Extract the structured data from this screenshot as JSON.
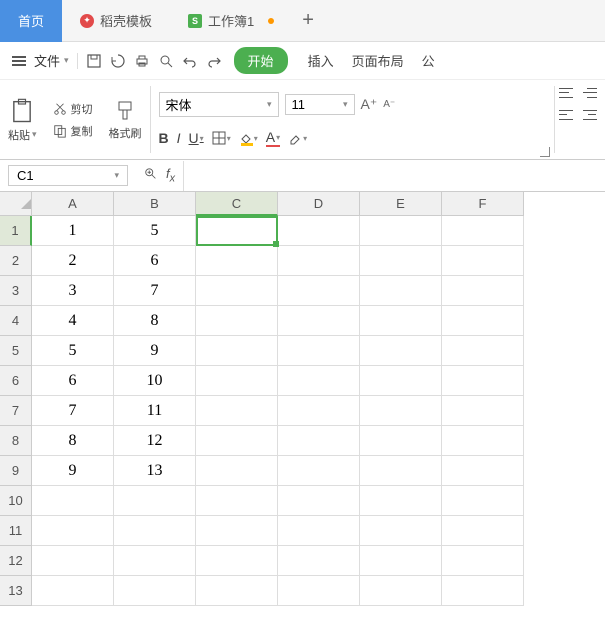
{
  "tabs": {
    "home": "首页",
    "template": "稻壳模板",
    "workbook": "工作簿1"
  },
  "menuBar": {
    "file": "文件",
    "begin": "开始",
    "insert": "插入",
    "pageLayout": "页面布局",
    "formula": "公"
  },
  "ribbon": {
    "paste": "粘贴",
    "cut": "剪切",
    "copy": "复制",
    "formatPainter": "格式刷",
    "fontName": "宋体",
    "fontSize": "11"
  },
  "nameBox": "C1",
  "formulaBar": "",
  "columns": [
    "A",
    "B",
    "C",
    "D",
    "E",
    "F"
  ],
  "rowNums": [
    1,
    2,
    3,
    4,
    5,
    6,
    7,
    8,
    9,
    10,
    11,
    12,
    13
  ],
  "activeCell": {
    "row": 1,
    "col": "C"
  },
  "cellData": {
    "A": [
      1,
      2,
      3,
      4,
      5,
      6,
      7,
      8,
      9
    ],
    "B": [
      5,
      6,
      7,
      8,
      9,
      10,
      11,
      12,
      13
    ]
  },
  "chart_data": {
    "type": "table",
    "title": "工作簿1",
    "columns": [
      "A",
      "B"
    ],
    "rows": [
      [
        1,
        5
      ],
      [
        2,
        6
      ],
      [
        3,
        7
      ],
      [
        4,
        8
      ],
      [
        5,
        9
      ],
      [
        6,
        10
      ],
      [
        7,
        11
      ],
      [
        8,
        12
      ],
      [
        9,
        13
      ]
    ]
  }
}
